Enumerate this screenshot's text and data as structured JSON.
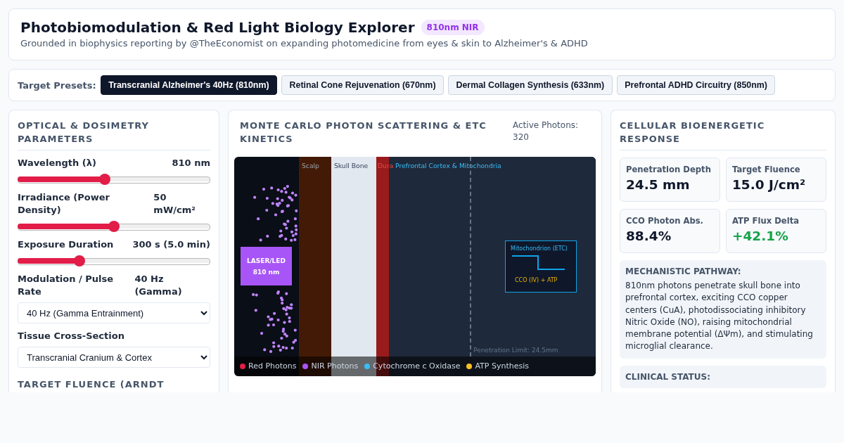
{
  "header": {
    "title": "Photobiomodulation & Red Light Biology Explorer",
    "badge": "810nm NIR",
    "subtitle": "Grounded in biophysics reporting by @TheEconomist on expanding photomedicine from eyes & skin to Alzheimer's & ADHD"
  },
  "presets": {
    "label": "Target Presets:",
    "items": [
      {
        "label": "Transcranial Alzheimer's 40Hz (810nm)",
        "selected": true
      },
      {
        "label": "Retinal Cone Rejuvenation (670nm)",
        "selected": false
      },
      {
        "label": "Dermal Collagen Synthesis (633nm)",
        "selected": false
      },
      {
        "label": "Prefrontal ADHD Circuitry (850nm)",
        "selected": false
      }
    ]
  },
  "parameters": {
    "title": "OPTICAL & DOSIMETRY PARAMETERS",
    "controls": [
      {
        "kind": "slider",
        "label": "Wavelength (λ)",
        "reading": "810 nm",
        "level": 0.45
      },
      {
        "kind": "slider",
        "label": "Irradiance (Power Density)",
        "reading": "50 mW/cm²",
        "level": 0.5
      },
      {
        "kind": "slider",
        "label": "Exposure Duration",
        "reading": "300 s (5.0 min)",
        "level": 0.31
      },
      {
        "kind": "select",
        "label": "Modulation / Pulse Rate",
        "reading": "40 Hz (Gamma)",
        "value": "40 Hz (Gamma Entrainment)"
      },
      {
        "kind": "select",
        "label": "Tissue Cross-Section",
        "value": "Transcranial Cranium & Cortex"
      }
    ],
    "next_section_title": "TARGET FLUENCE (ARNDT"
  },
  "simulation": {
    "title": "MONTE CARLO PHOTON SCATTERING & ETC KINETICS",
    "photon_count": "Active Photons: 320",
    "layers": [
      {
        "kind": "scalp",
        "label": "Scalp",
        "color": "#431a05"
      },
      {
        "kind": "bone",
        "label": "Skull Bone",
        "color": "#e2e8f0"
      },
      {
        "kind": "dura",
        "label": "Dura",
        "color": "#991b1b"
      },
      {
        "kind": "cortex",
        "label": "Prefrontal Cortex & Mitochondria",
        "color": "#1e293b"
      }
    ],
    "source": {
      "label": "LASER/LED",
      "wavelength": "810 nm"
    },
    "mitochondrion": {
      "title": "Mitochondrion (ETC)",
      "caption": "CCO (IV) + ATP"
    },
    "penetration_limit": "Penetration Limit: 24.5mm",
    "legend": [
      {
        "label": "Red Photons",
        "color": "#e11d48"
      },
      {
        "label": "NIR Photons",
        "color": "#a855f7"
      },
      {
        "label": "Cytochrome c Oxidase",
        "color": "#38bdf8"
      },
      {
        "label": "ATP Synthesis",
        "color": "#fbbf24"
      }
    ]
  },
  "response": {
    "title": "CELLULAR BIOENERGETIC RESPONSE",
    "metrics": [
      {
        "label": "Penetration Depth",
        "value": "24.5 mm",
        "color": "#0f172a"
      },
      {
        "label": "Target Fluence",
        "value": "15.0 J/cm²",
        "color": "#0f172a"
      },
      {
        "label": "CCO Photon Abs.",
        "value": "88.4%",
        "color": "#0f172a"
      },
      {
        "label": "ATP Flux Delta",
        "value": "+42.1%",
        "color": "#16a34a"
      }
    ],
    "mechanism": {
      "title": "MECHANISTIC PATHWAY:",
      "text": "810nm photons penetrate skull bone into prefrontal cortex, exciting CCO copper centers (CuA), photodissociating inhibitory Nitric Oxide (NO), raising mitochondrial membrane potential (ΔΨm), and stimulating microglial clearance."
    },
    "clinical_status": {
      "title": "CLINICAL STATUS:"
    }
  }
}
